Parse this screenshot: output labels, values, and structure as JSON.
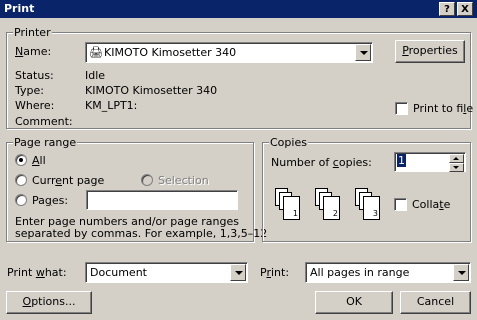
{
  "window": {
    "title": "Print"
  },
  "titlebar_buttons": {
    "help": "?",
    "close": "X"
  },
  "printer": {
    "group_label": "Printer",
    "name_label": "Name:",
    "name_value": "KIMOTO Kimosetter 340",
    "properties_label": "Properties",
    "status_label": "Status:",
    "status_value": "Idle",
    "type_label": "Type:",
    "type_value": "KIMOTO Kimosetter 340",
    "where_label": "Where:",
    "where_value": "KM_LPT1:",
    "comment_label": "Comment:",
    "comment_value": "",
    "print_to_file_label": "Print to file"
  },
  "page_range": {
    "group_label": "Page range",
    "all_label": "All",
    "current_page_label": "Current page",
    "selection_label": "Selection",
    "pages_label": "Pages:",
    "pages_value": "",
    "hint_line1": "Enter page numbers and/or page ranges",
    "hint_line2": "separated by commas.  For example, 1,3,5–12"
  },
  "copies": {
    "group_label": "Copies",
    "number_label": "Number of copies:",
    "number_value": "1",
    "collate_label": "Collate",
    "page_numbers": [
      "1",
      "2",
      "3"
    ]
  },
  "print_what": {
    "label": "Print what:",
    "value": "Document"
  },
  "print": {
    "label": "Print:",
    "value": "All pages in range"
  },
  "buttons": {
    "options": "Options...",
    "ok": "OK",
    "cancel": "Cancel"
  }
}
